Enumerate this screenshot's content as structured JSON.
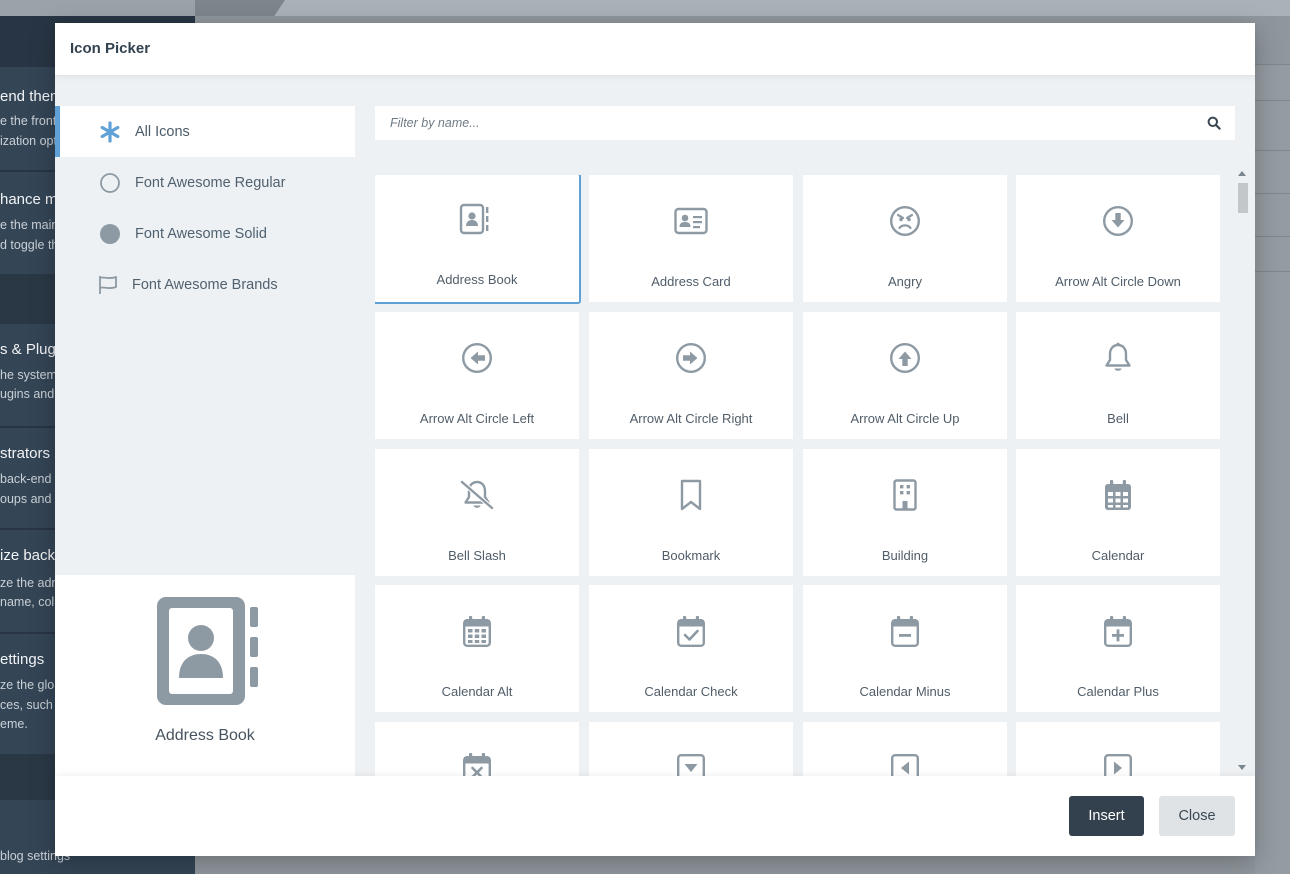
{
  "background": {
    "sections": [
      {
        "title": "end them",
        "lines": [
          "e the front-",
          "ization opt"
        ]
      },
      {
        "title": "hance mo",
        "lines": [
          "e the main",
          "d toggle th"
        ]
      },
      {
        "title": "s & Plug",
        "lines": [
          "he system",
          "ugins and"
        ]
      },
      {
        "title": "strators",
        "lines": [
          "back-end",
          "oups and"
        ]
      },
      {
        "title": "ize back",
        "lines": [
          "ze the adm",
          "name, col"
        ]
      },
      {
        "title": "ettings",
        "lines": [
          "ze the glob",
          "ces, such",
          "eme."
        ]
      }
    ],
    "footer_text": "blog settings"
  },
  "modal": {
    "title": "Icon Picker",
    "categories": [
      {
        "label": "All Icons",
        "icon": "asterisk-icon",
        "active": true
      },
      {
        "label": "Font Awesome Regular",
        "icon": "circle-outline-icon",
        "active": false
      },
      {
        "label": "Font Awesome Solid",
        "icon": "circle-solid-icon",
        "active": false
      },
      {
        "label": "Font Awesome Brands",
        "icon": "flag-icon",
        "active": false
      }
    ],
    "filter": {
      "placeholder": "Filter by name...",
      "value": ""
    },
    "preview": {
      "name": "Address Book",
      "icon": "address-book-icon"
    },
    "icons": [
      {
        "label": "Address Book",
        "icon": "address-book-icon",
        "selected": true
      },
      {
        "label": "Address Card",
        "icon": "address-card-icon"
      },
      {
        "label": "Angry",
        "icon": "angry-icon"
      },
      {
        "label": "Arrow Alt Circle Down",
        "icon": "arrow-alt-circle-down-icon"
      },
      {
        "label": "Arrow Alt Circle Left",
        "icon": "arrow-alt-circle-left-icon"
      },
      {
        "label": "Arrow Alt Circle Right",
        "icon": "arrow-alt-circle-right-icon"
      },
      {
        "label": "Arrow Alt Circle Up",
        "icon": "arrow-alt-circle-up-icon"
      },
      {
        "label": "Bell",
        "icon": "bell-icon"
      },
      {
        "label": "Bell Slash",
        "icon": "bell-slash-icon"
      },
      {
        "label": "Bookmark",
        "icon": "bookmark-icon"
      },
      {
        "label": "Building",
        "icon": "building-icon"
      },
      {
        "label": "Calendar",
        "icon": "calendar-icon"
      },
      {
        "label": "Calendar Alt",
        "icon": "calendar-alt-icon"
      },
      {
        "label": "Calendar Check",
        "icon": "calendar-check-icon"
      },
      {
        "label": "Calendar Minus",
        "icon": "calendar-minus-icon"
      },
      {
        "label": "Calendar Plus",
        "icon": "calendar-plus-icon"
      },
      {
        "label": "",
        "icon": "calendar-times-icon"
      },
      {
        "label": "",
        "icon": "caret-square-down-icon"
      },
      {
        "label": "",
        "icon": "caret-square-left-icon"
      },
      {
        "label": "",
        "icon": "caret-square-right-icon"
      }
    ],
    "buttons": {
      "insert": "Insert",
      "close": "Close"
    },
    "colors": {
      "accent": "#5fa1d6",
      "icon": "#8e9aa3",
      "primary_button": "#33414f"
    }
  }
}
